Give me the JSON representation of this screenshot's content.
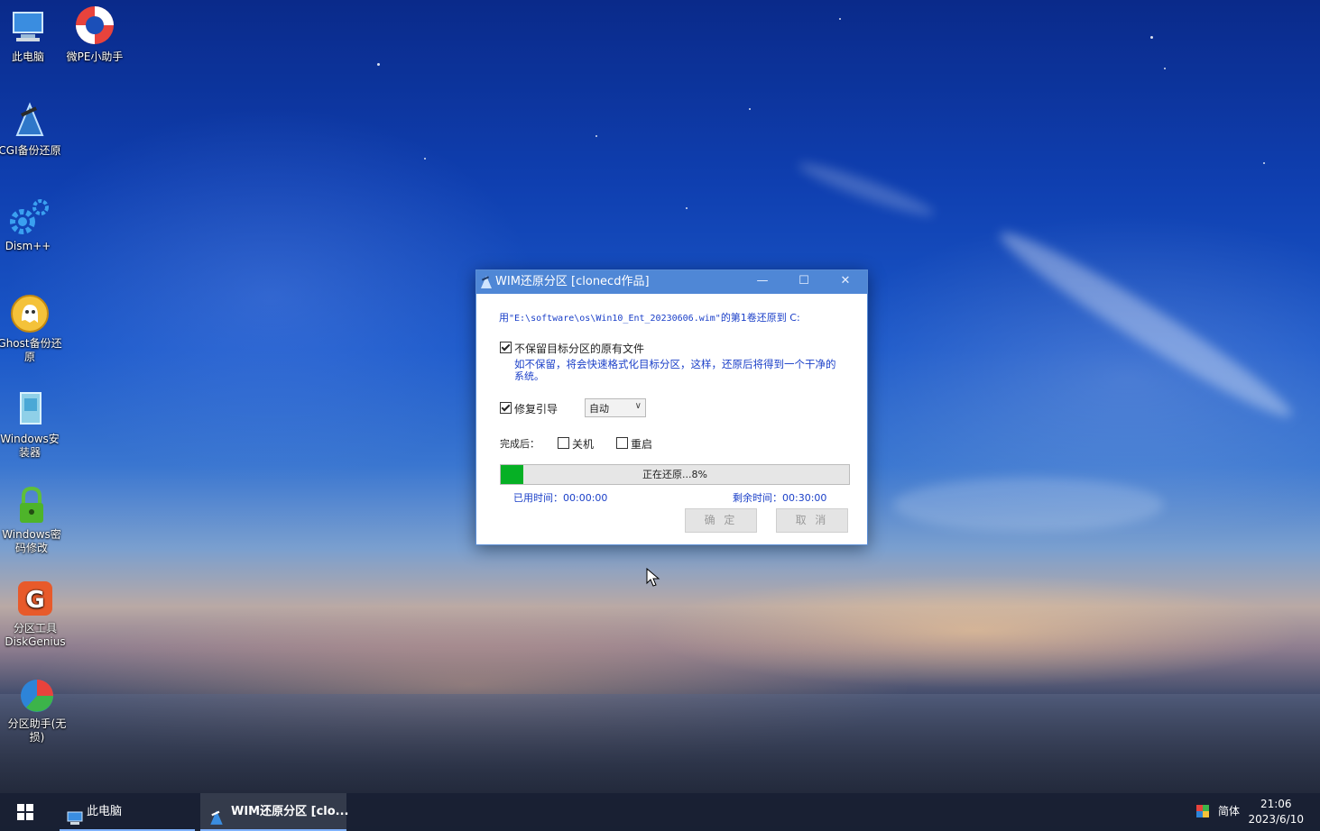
{
  "desktop": {
    "icons": [
      {
        "label": "此电脑"
      },
      {
        "label": "微PE小助手"
      },
      {
        "label": "CGI备份还原"
      },
      {
        "label": "Dism++"
      },
      {
        "label": "Ghost备份还原"
      },
      {
        "label": "Windows安装器"
      },
      {
        "label": "Windows密码修改"
      },
      {
        "label": "分区工具DiskGenius"
      },
      {
        "label": "分区助手(无损)"
      }
    ]
  },
  "dialog": {
    "title": "WIM还原分区 [clonecd作品]",
    "controls": {
      "minimize": "—",
      "maximize": "☐",
      "close": "✕"
    },
    "message_prefix": "用",
    "message_path": "\"E:\\software\\os\\Win10_Ent_20230606.wim\"",
    "message_suffix": "的第1卷还原到 C:",
    "no_keep_label": "不保留目标分区的原有文件",
    "no_keep_checked": true,
    "no_keep_hint_line1": "如不保留，将会快速格式化目标分区，这样，还原后将得到一个干净的",
    "no_keep_hint_line2": "系统。",
    "repair_boot_label": "修复引导",
    "repair_boot_checked": true,
    "repair_boot_option": "自动",
    "after_label": "完成后：",
    "shutdown_label": "关机",
    "shutdown_checked": false,
    "restart_label": "重启",
    "restart_checked": false,
    "progress_text": "正在还原...8%",
    "progress_fraction": 0.065,
    "elapsed_label": "已用时间：00:00:00",
    "remaining_label": "剩余时间：00:30:00",
    "ok_label": "确 定",
    "cancel_label": "取 消"
  },
  "taskbar": {
    "app1_label": "此电脑",
    "app2_label": "WIM还原分区 [clo...",
    "ime_label": "简体",
    "time": "21:06",
    "date": "2023/6/10"
  },
  "colors": {
    "titlebar": "#4f87d6",
    "progress": "#06b025",
    "link_text": "#1a3fc8"
  }
}
